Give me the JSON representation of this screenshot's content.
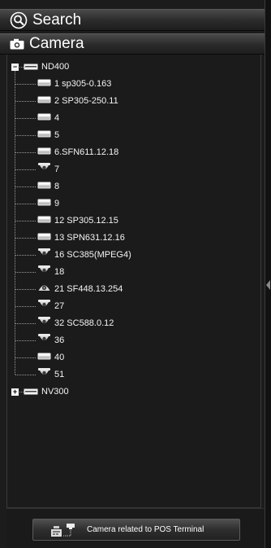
{
  "search_header": {
    "title": "Search",
    "icon": "magnifier-icon"
  },
  "camera_header": {
    "title": "Camera",
    "icon": "camera-icon"
  },
  "tree": {
    "groups": [
      {
        "label": "ND400",
        "expanded": true,
        "expander": "−",
        "devices": [
          {
            "label": "1 sp305-0.163",
            "type": "box"
          },
          {
            "label": "2 SP305-250.11",
            "type": "box"
          },
          {
            "label": "4",
            "type": "box"
          },
          {
            "label": "5",
            "type": "box"
          },
          {
            "label": "6.SFN611.12.18",
            "type": "box"
          },
          {
            "label": "7",
            "type": "dome"
          },
          {
            "label": "8",
            "type": "box"
          },
          {
            "label": "9",
            "type": "box"
          },
          {
            "label": "12 SP305.12.15",
            "type": "box"
          },
          {
            "label": "13 SPN631.12.16",
            "type": "box"
          },
          {
            "label": "16 SC385(MPEG4)",
            "type": "dome"
          },
          {
            "label": "18",
            "type": "dome"
          },
          {
            "label": "21 SF448.13.254",
            "type": "fisheye"
          },
          {
            "label": "27",
            "type": "dome"
          },
          {
            "label": "32 SC588.0.12",
            "type": "dome"
          },
          {
            "label": "36",
            "type": "dome"
          },
          {
            "label": "40",
            "type": "box"
          },
          {
            "label": "51",
            "type": "dome"
          }
        ]
      },
      {
        "label": "NV300",
        "expanded": false,
        "expander": "+"
      }
    ]
  },
  "footer": {
    "pos_button_label": "Camera related to POS Terminal"
  },
  "colors": {
    "background": "#1c1c1c",
    "text": "#f2f2f2",
    "tree_lines": "#9a9a9a"
  }
}
